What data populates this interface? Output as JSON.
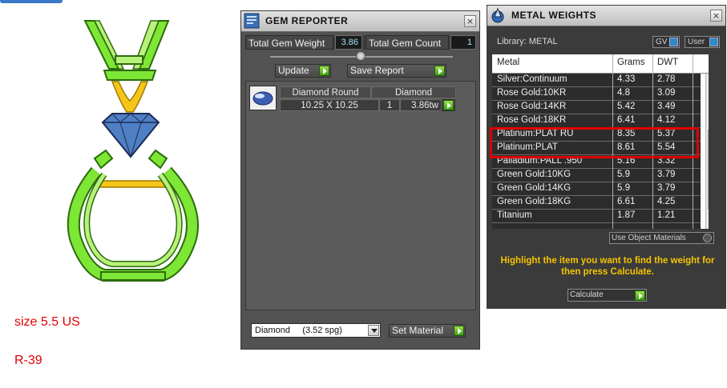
{
  "canvas": {
    "size_label": "size 5.5 US",
    "ref_label": "R-39",
    "colors": {
      "metal": "#7ee634",
      "accent_metal": "#f5c518",
      "gem": "#4f7fc4",
      "label": "#e00000"
    }
  },
  "gem_reporter": {
    "title": "GEM REPORTER",
    "close": "×",
    "total_weight_label": "Total Gem Weight",
    "total_weight_value": "3.86",
    "total_count_label": "Total Gem Count",
    "total_count_value": "1",
    "update_label": "Update",
    "save_report_label": "Save Report",
    "gem_entry": {
      "shape_header": "Diamond Round",
      "type_header": "Diamond",
      "size": "10.25 X 10.25",
      "count": "1",
      "weight": "3.86tw"
    },
    "material_select": "Diamond     (3.52 spg)",
    "set_material_label": "Set Material"
  },
  "metal_weights": {
    "title": "METAL WEIGHTS",
    "close": "×",
    "library_label": "Library: METAL",
    "gv_toggle": "GV",
    "user_toggle": "User",
    "columns": [
      "Metal",
      "Grams",
      "DWT"
    ],
    "rows": [
      {
        "metal": "Silver:Continuum",
        "grams": "4.33",
        "dwt": "2.78"
      },
      {
        "metal": "Rose Gold:10KR",
        "grams": "4.8",
        "dwt": "3.09"
      },
      {
        "metal": "Rose Gold:14KR",
        "grams": "5.42",
        "dwt": "3.49"
      },
      {
        "metal": "Rose Gold:18KR",
        "grams": "6.41",
        "dwt": "4.12"
      },
      {
        "metal": "Platinum:PLAT RU",
        "grams": "8.35",
        "dwt": "5.37"
      },
      {
        "metal": "Platinum:PLAT",
        "grams": "8.61",
        "dwt": "5.54"
      },
      {
        "metal": "Palladium:PALL .950",
        "grams": "5.16",
        "dwt": "3.32"
      },
      {
        "metal": "Green Gold:10KG",
        "grams": "5.9",
        "dwt": "3.79"
      },
      {
        "metal": "Green Gold:14KG",
        "grams": "5.9",
        "dwt": "3.79"
      },
      {
        "metal": "Green Gold:18KG",
        "grams": "6.61",
        "dwt": "4.25"
      },
      {
        "metal": "Titanium",
        "grams": "1.87",
        "dwt": "1.21"
      }
    ],
    "use_object_materials": "Use Object Materials",
    "hint": "Highlight the item you want to find the weight for then press Calculate.",
    "calculate_label": "Calculate"
  }
}
